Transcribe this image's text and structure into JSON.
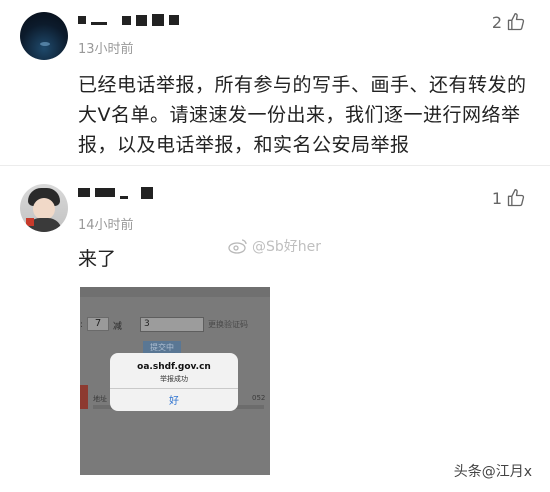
{
  "comments": [
    {
      "time": "13小时前",
      "likes": "2",
      "text": "已经电话举报，所有参与的写手、画手、还有转发的大V名单。请速速发一份出来，我们逐一进行网络举报，以及电话举报，和实名公安局举报"
    },
    {
      "time": "14小时前",
      "likes": "1",
      "text": "来了"
    }
  ],
  "watermark": "@Sb好her",
  "screenshot": {
    "field_value": "7",
    "operator": "减",
    "answer": "3",
    "refresh_label": "更换验证码",
    "submit_label": "提交中",
    "address_label": "地址",
    "number_text": "052",
    "dialog": {
      "title": "oa.shdf.gov.cn",
      "message": "举报成功",
      "ok_label": "好"
    }
  },
  "source": "头条@江月x",
  "colors": {
    "like_icon": "#666666",
    "dialog_button": "#2f74d0"
  },
  "icons": {
    "like": "thumbs-up-icon",
    "weibo": "weibo-icon"
  }
}
